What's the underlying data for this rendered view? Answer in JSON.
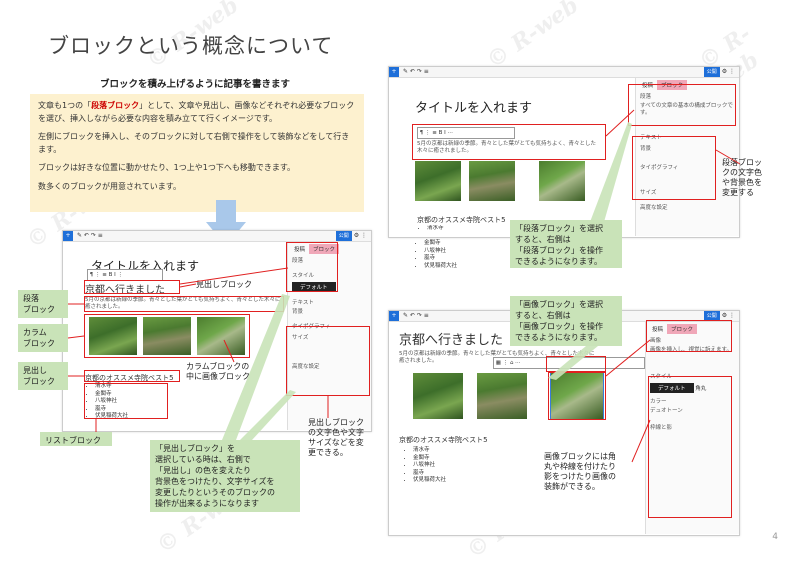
{
  "slide": {
    "title": "ブロックという概念について",
    "subtitle": "ブロックを積み上げるように記事を書きます",
    "page_number": "4",
    "watermark": "© R-web"
  },
  "intro": {
    "line1_pre": "文章も1つの「",
    "line1_bold": "段落ブロック",
    "line1_post": "」として、文章や見出し、画像などそれぞれ必要なブロックを選び、挿入しながら必要な内容を積み立てて行くイメージです。",
    "line2": "左側にブロックを挿入し、そのブロックに対して右側で操作をして装飾などをして行きます。",
    "line3": "ブロックは好きな位置に動かせたり、1つ上や1つ下へも移動できます。",
    "line4": "数多くのブロックが用意されています。"
  },
  "editor_common": {
    "post_title": "タイトルを入れます",
    "heading": "京都へ行きました",
    "paragraph": "5月の京都は新緑の季節。青々とした葉がとても気持ちよく、青々とした木々に癒されました。",
    "subheading": "京都のオススメ寺院ベスト5",
    "list_items": [
      "清水寺",
      "金閣寺",
      "八坂神社",
      "嵐寺",
      "伏見稲荷大社"
    ],
    "tab_post": "投稿",
    "tab_block": "ブロック",
    "save_label": "公開",
    "block_name_paragraph": "段落",
    "block_desc_paragraph": "すべての文章の基本の構成ブロックです。",
    "block_name_image": "画像",
    "block_desc_image": "画像を挿入し、視覚に訴えます。",
    "style_label": "スタイル",
    "style_default": "デフォルト",
    "style_rounded": "角丸",
    "text_label": "テキスト",
    "background_label": "背景",
    "typography_label": "タイポグラフィ",
    "size_label": "サイズ",
    "advanced_label": "高度な設定",
    "border_label": "枠線と影",
    "color_label": "カラー",
    "duotone_label": "デュオトーン"
  },
  "left_annotations": {
    "heading_block": "見出しブロック",
    "paragraph_block": "段落\nブロック",
    "column_block": "カラム\nブロック",
    "heading_block2": "見出し\nブロック",
    "list_block": "リストブロック",
    "column_image": "カラムブロックの\n中に画像ブロック",
    "heading_select": "「見出しブロック」を\n選択している時は、右側で\n「見出し」の色を変えたり\n背景色をつけたり、文字サイズを\n変更したりというそのブロックの\n操作が出来るようになります",
    "heading_right": "見出しブロック\nの文字色や文字\nサイズなどを変\n更できる。"
  },
  "right_annotations": {
    "paragraph_select": "「段落ブロック」を選択\nすると、右側は\n「段落ブロック」を操作\nできるようになります。",
    "paragraph_color": "段落ブロッ\nクの文字色\nや背景色を\n変更する",
    "image_select": "「画像ブロック」を選択\nすると、右側は\n「画像ブロック」を操作\nできるようになります。",
    "image_style": "画像ブロックには角\n丸や枠線を付けたり\n影をつけたり画像の\n装飾ができる。"
  }
}
